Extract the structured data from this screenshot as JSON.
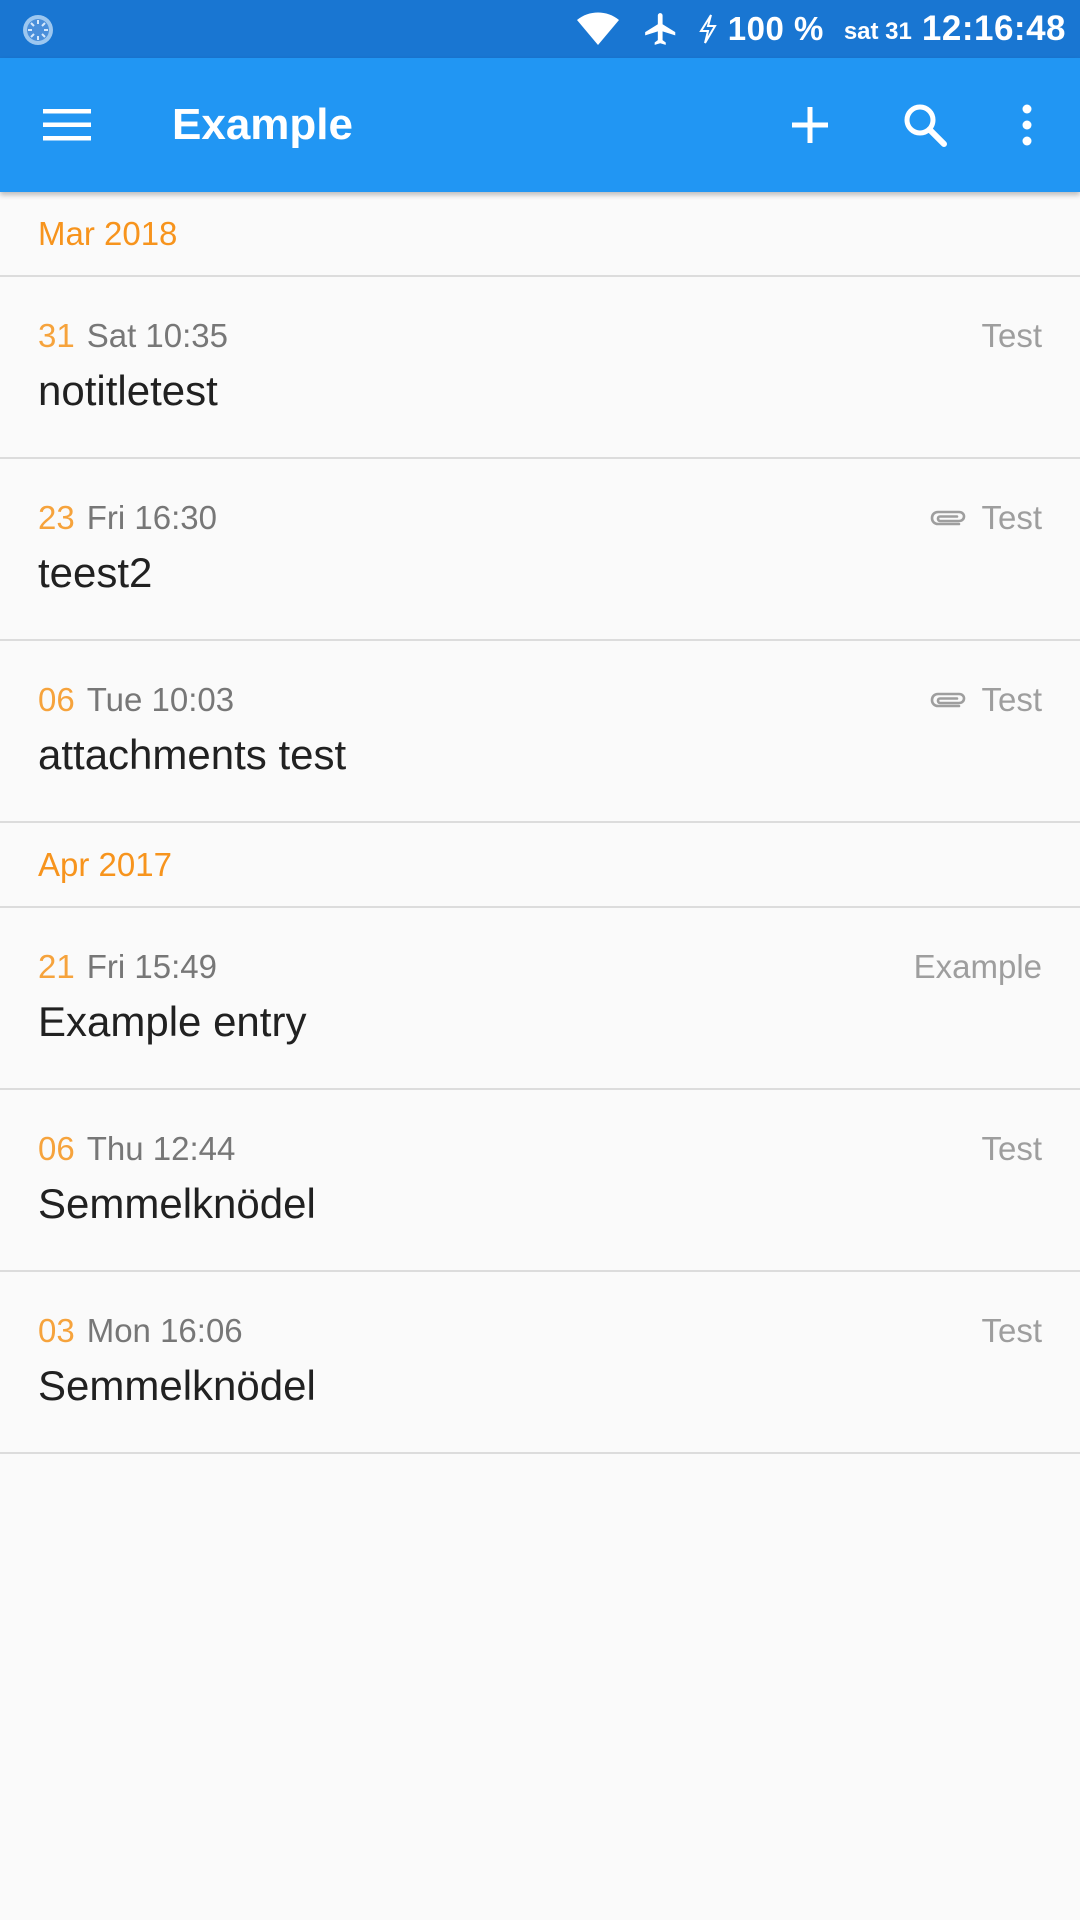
{
  "status_bar": {
    "battery": "100 %",
    "date": "sat 31",
    "time": "12:16:48",
    "icons": [
      "app-notification-icon",
      "wifi-icon",
      "airplane-mode-icon",
      "charging-icon"
    ]
  },
  "app_bar": {
    "title": "Example",
    "icons": [
      "menu-icon",
      "add-icon",
      "search-icon",
      "more-vert-icon"
    ]
  },
  "colors": {
    "status_bar": "#1976d2",
    "app_bar": "#2196f3",
    "month_header": "#f7941d",
    "day_number": "#f6a33c",
    "background": "#fafafa"
  },
  "groups": [
    {
      "month": "Mar 2018",
      "entries": [
        {
          "day": "31",
          "weekday_time": "Sat 10:35",
          "title": "notitletest",
          "tag": "Test",
          "has_attachment": false
        },
        {
          "day": "23",
          "weekday_time": "Fri 16:30",
          "title": "teest2",
          "tag": "Test",
          "has_attachment": true
        },
        {
          "day": "06",
          "weekday_time": "Tue 10:03",
          "title": "attachments test",
          "tag": "Test",
          "has_attachment": true
        }
      ]
    },
    {
      "month": "Apr 2017",
      "entries": [
        {
          "day": "21",
          "weekday_time": "Fri 15:49",
          "title": "Example entry",
          "tag": "Example",
          "has_attachment": false
        },
        {
          "day": "06",
          "weekday_time": "Thu 12:44",
          "title": "Semmelknödel",
          "tag": "Test",
          "has_attachment": false
        },
        {
          "day": "03",
          "weekday_time": "Mon 16:06",
          "title": "Semmelknödel",
          "tag": "Test",
          "has_attachment": false
        }
      ]
    }
  ]
}
